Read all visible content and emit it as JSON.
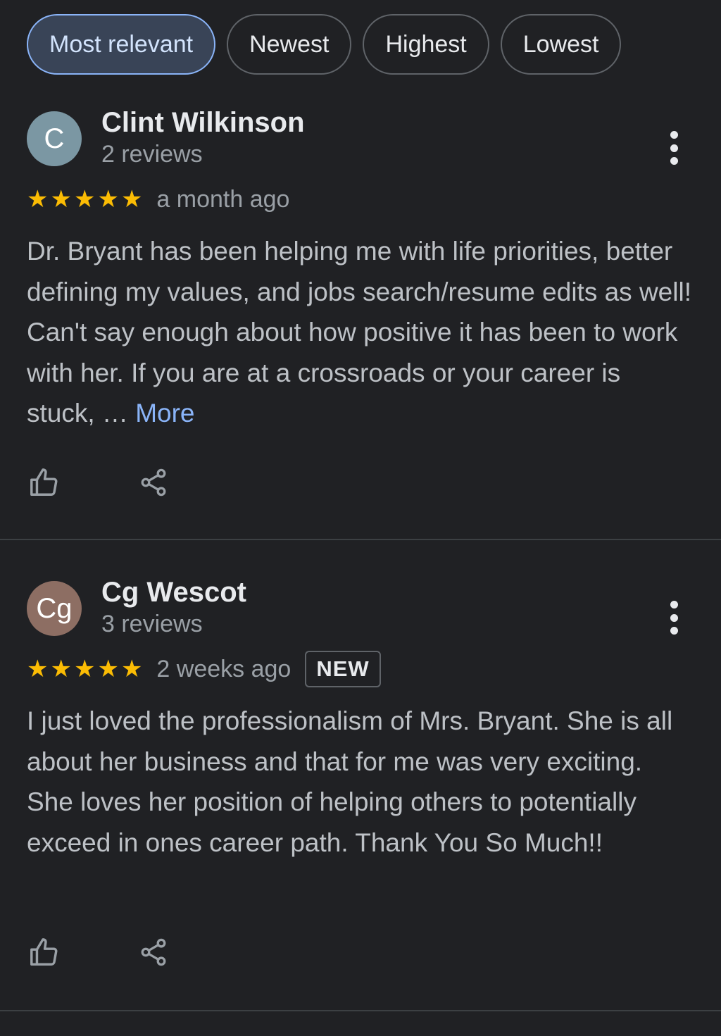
{
  "filters": [
    "Most relevant",
    "Newest",
    "Highest",
    "Lowest"
  ],
  "reviews": [
    {
      "avatar_letter": "C",
      "avatar_color": "#7b97a3",
      "name": "Clint Wilkinson",
      "review_count": "2 reviews",
      "rating": 5,
      "time": "a month ago",
      "badge": "",
      "text": "Dr. Bryant has been helping me with life priorities, better defining my values, and jobs search/resume edits as well! Can't say enough about how positive it has been to work with her. If you are at a crossroads or your career is stuck, … ",
      "more": "More"
    },
    {
      "avatar_letter": "Cg",
      "avatar_color": "#8d6e63",
      "name": "Cg Wescot",
      "review_count": "3 reviews",
      "rating": 5,
      "time": "2 weeks ago",
      "badge": "NEW",
      "text": "I just loved the professionalism of Mrs. Bryant. She is all about her business and that for me was very exciting. She loves her position of helping others to potentially exceed in ones career path. Thank You So Much!!",
      "more": ""
    }
  ],
  "colors": {
    "background": "#202124",
    "star": "#fbbc04",
    "link": "#8ab4f8",
    "active_chip": "#394457"
  },
  "icons": [
    "thumbs-up-icon",
    "share-icon",
    "more-vert-icon",
    "star-icon"
  ]
}
